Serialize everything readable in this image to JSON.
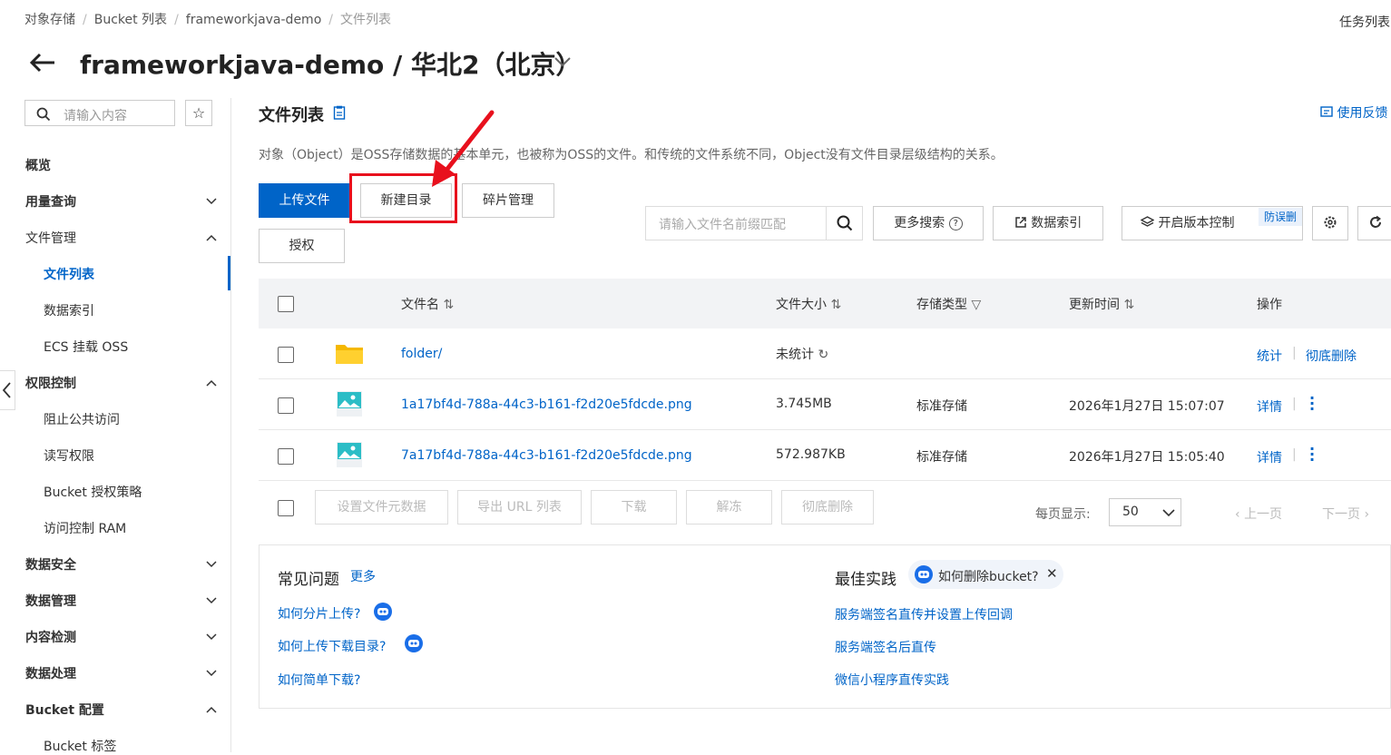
{
  "breadcrumb": [
    "对象存储",
    "Bucket 列表",
    "frameworkjava-demo",
    "文件列表"
  ],
  "task_list": "任务列表",
  "title": "frameworkjava-demo / 华北2（北京）",
  "sidebar": {
    "search_placeholder": "请输入内容",
    "items": [
      {
        "label": "概览"
      },
      {
        "label": "用量查询"
      },
      {
        "label": "文件管理"
      },
      {
        "label": "文件列表"
      },
      {
        "label": "数据索引"
      },
      {
        "label": "ECS 挂载 OSS"
      },
      {
        "label": "权限控制"
      },
      {
        "label": "阻止公共访问"
      },
      {
        "label": "读写权限"
      },
      {
        "label": "Bucket 授权策略"
      },
      {
        "label": "访问控制 RAM"
      },
      {
        "label": "数据安全"
      },
      {
        "label": "数据管理"
      },
      {
        "label": "内容检测"
      },
      {
        "label": "数据处理"
      },
      {
        "label": "Bucket 配置"
      },
      {
        "label": "Bucket 标签"
      }
    ]
  },
  "main": {
    "heading": "文件列表",
    "feedback": "使用反馈",
    "description": "对象（Object）是OSS存储数据的基本单元，也被称为OSS的文件。和传统的文件系统不同，Object没有文件目录层级结构的关系。",
    "buttons": {
      "upload": "上传文件",
      "new_dir": "新建目录",
      "fragments": "碎片管理",
      "authorize": "授权",
      "more_search": "更多搜索",
      "data_index": "数据索引",
      "versioning": "开启版本控制",
      "versioning_badge": "防误删"
    },
    "search_placeholder": "请输入文件名前缀匹配",
    "table": {
      "headers": [
        "文件名",
        "文件大小",
        "存储类型",
        "更新时间",
        "操作"
      ],
      "rows": [
        {
          "name": "folder/",
          "size": "未统计",
          "type": "",
          "time": "",
          "action1": "统计",
          "action2": "彻底删除"
        },
        {
          "name": "1a17bf4d-788a-44c3-b161-f2d20e5fdcde.png",
          "size": "3.745MB",
          "type": "标准存储",
          "time": "2026年1月27日 15:07:07",
          "action1": "详情",
          "action2": ""
        },
        {
          "name": "7a17bf4d-788a-44c3-b161-f2d20e5fdcde.png",
          "size": "572.987KB",
          "type": "标准存储",
          "time": "2026年1月27日 15:05:40",
          "action1": "详情",
          "action2": ""
        }
      ]
    },
    "bulk_actions": [
      "设置文件元数据",
      "导出 URL 列表",
      "下载",
      "解冻",
      "彻底删除"
    ],
    "pager": {
      "label": "每页显示:",
      "size": "50",
      "prev": "上一页",
      "next": "下一页"
    }
  },
  "faq": {
    "common_title": "常见问题",
    "more": "更多",
    "common_links": [
      "如何分片上传?",
      "如何上传下载目录?",
      "如何简单下载?"
    ],
    "best_title": "最佳实践",
    "chip": "如何删除bucket?",
    "best_links": [
      "服务端签名直传并设置上传回调",
      "服务端签名后直传",
      "微信小程序直传实践"
    ]
  },
  "colors": {
    "accent": "#0064c8",
    "highlight": "#e8101d"
  }
}
